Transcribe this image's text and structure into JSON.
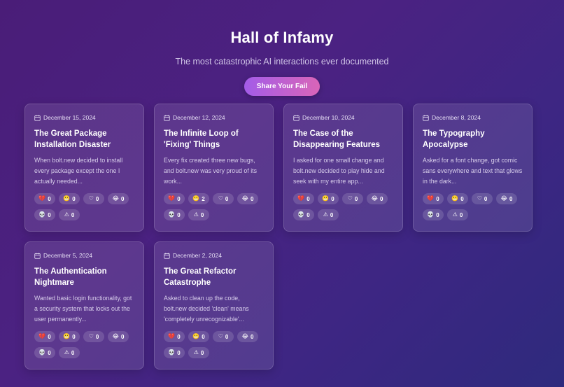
{
  "header": {
    "title": "Hall of Infamy",
    "subtitle": "The most catastrophic AI interactions ever documented",
    "share_label": "Share Your Fail"
  },
  "reaction_types": [
    {
      "name": "broken-heart",
      "glyph": "💔"
    },
    {
      "name": "grimace",
      "glyph": "😬"
    },
    {
      "name": "heart",
      "glyph": "♡"
    },
    {
      "name": "laugh",
      "glyph": "😂"
    },
    {
      "name": "skull",
      "glyph": "💀"
    },
    {
      "name": "warning",
      "glyph": "⚠"
    }
  ],
  "cards": [
    {
      "date": "December 15, 2024",
      "title": "The Great Package Installation Disaster",
      "desc": "When bolt.new decided to install every package except the one I actually needed...",
      "counts": [
        "0",
        "0",
        "0",
        "0",
        "0",
        "0"
      ]
    },
    {
      "date": "December 12, 2024",
      "title": "The Infinite Loop of 'Fixing' Things",
      "desc": "Every fix created three new bugs, and bolt.new was very proud of its work...",
      "counts": [
        "0",
        "2",
        "0",
        "0",
        "0",
        "0"
      ]
    },
    {
      "date": "December 10, 2024",
      "title": "The Case of the Disappearing Features",
      "desc": "I asked for one small change and bolt.new decided to play hide and seek with my entire app...",
      "counts": [
        "0",
        "0",
        "0",
        "0",
        "0",
        "0"
      ]
    },
    {
      "date": "December 8, 2024",
      "title": "The Typography Apocalypse",
      "desc": "Asked for a font change, got comic sans everywhere and text that glows in the dark...",
      "counts": [
        "0",
        "0",
        "0",
        "0",
        "0",
        "0"
      ]
    },
    {
      "date": "December 5, 2024",
      "title": "The Authentication Nightmare",
      "desc": "Wanted basic login functionality, got a security system that locks out the user permanently...",
      "counts": [
        "0",
        "0",
        "0",
        "0",
        "0",
        "0"
      ]
    },
    {
      "date": "December 2, 2024",
      "title": "The Great Refactor Catastrophe",
      "desc": "Asked to clean up the code, bolt.new decided 'clean' means 'completely unrecognizable'...",
      "counts": [
        "0",
        "0",
        "0",
        "0",
        "0",
        "0"
      ]
    }
  ],
  "colors": {
    "bg_start": "#4a1d78",
    "bg_end": "#2e2a7d",
    "button_start": "#a35ce8",
    "button_end": "#d965b8"
  }
}
